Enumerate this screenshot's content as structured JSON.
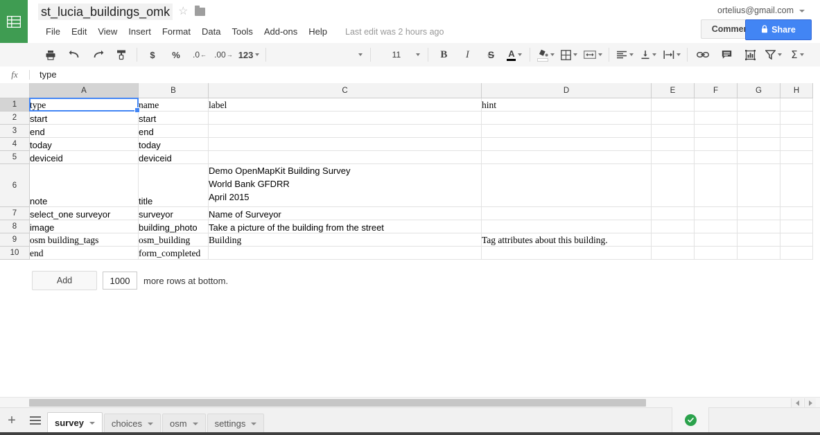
{
  "header": {
    "logo_icon": "sheets-grid-icon",
    "doc_title": "st_lucia_buildings_omk",
    "star_icon": "☆",
    "folder_icon": "folder-icon",
    "menus": [
      "File",
      "Edit",
      "View",
      "Insert",
      "Format",
      "Data",
      "Tools",
      "Add-ons",
      "Help"
    ],
    "last_edit": "Last edit was 2 hours ago",
    "account_email": "ortelius@gmail.com",
    "comments_label": "Comments",
    "share_label": "Share",
    "share_lock_icon": "🔒",
    "share_color": "#4285f4"
  },
  "toolbar": {
    "print_icon": "⎙",
    "undo_icon": "↶",
    "redo_icon": "↷",
    "paint_format_icon": "paint-roller-icon",
    "currency_label": "$",
    "percent_label": "%",
    "decrease_decimal_label": ".0",
    "increase_decimal_label": ".00",
    "more_formats_label": "123",
    "font_name": "",
    "font_size": "11",
    "bold_label": "B",
    "italic_label": "I",
    "strikethrough_label": "S",
    "text_color_label": "A",
    "text_color_value": "#000000",
    "fill_color_icon": "paint-bucket-icon",
    "borders_icon": "borders-icon",
    "merge_icon": "merge-cells-icon",
    "halign_icon": "horizontal-align-icon",
    "valign_icon": "vertical-align-icon",
    "wrap_icon": "text-wrap-icon",
    "link_icon": "⚭",
    "comment_icon": "insert-comment-icon",
    "chart_icon": "insert-chart-icon",
    "filter_icon": "filter-icon",
    "functions_label": "Σ"
  },
  "formula_bar": {
    "fx_label": "fx",
    "value": "type"
  },
  "grid": {
    "columns": [
      "A",
      "B",
      "C",
      "D",
      "E",
      "F",
      "G",
      "H"
    ],
    "selected_column": "A",
    "selected_row": "1",
    "selected_cell": "A1",
    "rows": [
      {
        "num": "1",
        "tall": false,
        "serif": true,
        "cells": [
          "type",
          "name",
          "label",
          "hint",
          "",
          "",
          "",
          ""
        ]
      },
      {
        "num": "2",
        "tall": false,
        "serif": false,
        "cells": [
          "start",
          "start",
          "",
          "",
          "",
          "",
          "",
          ""
        ]
      },
      {
        "num": "3",
        "tall": false,
        "serif": false,
        "cells": [
          "end",
          "end",
          "",
          "",
          "",
          "",
          "",
          ""
        ]
      },
      {
        "num": "4",
        "tall": false,
        "serif": false,
        "cells": [
          "today",
          "today",
          "",
          "",
          "",
          "",
          "",
          ""
        ]
      },
      {
        "num": "5",
        "tall": false,
        "serif": false,
        "cells": [
          "deviceid",
          "deviceid",
          "",
          "",
          "",
          "",
          "",
          ""
        ]
      },
      {
        "num": "6",
        "tall": true,
        "serif": false,
        "cells": [
          "note",
          "title",
          "Demo OpenMapKit Building Survey\nWorld Bank GFDRR\nApril 2015",
          "",
          "",
          "",
          "",
          ""
        ]
      },
      {
        "num": "7",
        "tall": false,
        "serif": false,
        "cells": [
          "select_one surveyor",
          "surveyor",
          "Name of Surveyor",
          "",
          "",
          "",
          "",
          ""
        ]
      },
      {
        "num": "8",
        "tall": false,
        "serif": false,
        "cells": [
          "image",
          "building_photo",
          "Take a picture of the building from the street",
          "",
          "",
          "",
          "",
          ""
        ]
      },
      {
        "num": "9",
        "tall": false,
        "serif": true,
        "cells": [
          "osm building_tags",
          "osm_building",
          "Building",
          "Tag attributes about this building.",
          "",
          "",
          "",
          ""
        ]
      },
      {
        "num": "10",
        "tall": false,
        "serif": true,
        "cells": [
          "end",
          "form_completed",
          "",
          "",
          "",
          "",
          "",
          ""
        ]
      }
    ]
  },
  "add_rows": {
    "button_label": "Add",
    "count_value": "1000",
    "suffix_label": "more rows at bottom."
  },
  "tab_bar": {
    "add_sheet_icon": "+",
    "all_sheets_icon": "sheet-list-icon",
    "tabs": [
      {
        "label": "survey",
        "active": true
      },
      {
        "label": "choices",
        "active": false
      },
      {
        "label": "osm",
        "active": false
      },
      {
        "label": "settings",
        "active": false
      }
    ],
    "status_icon": "green-check-icon",
    "status_color": "#2ba24c"
  },
  "scrollbar": {
    "left_arrow_icon": "scroll-left-icon",
    "right_arrow_icon": "scroll-right-icon"
  }
}
